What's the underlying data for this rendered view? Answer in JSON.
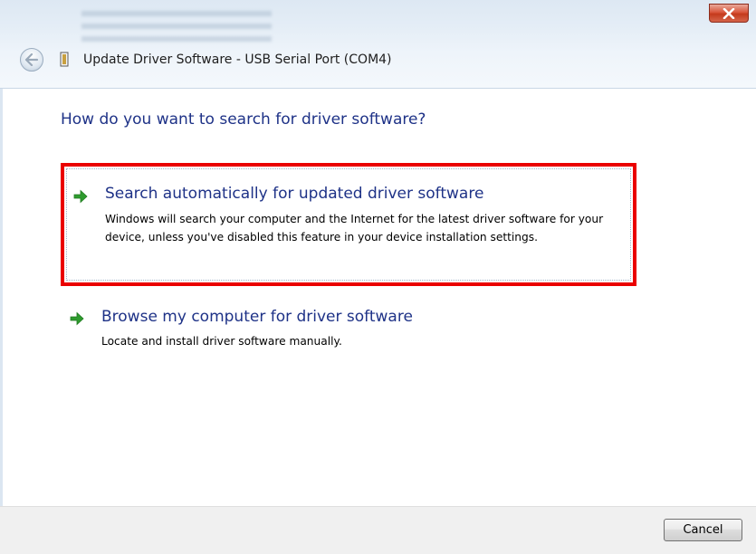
{
  "window": {
    "title": "Update Driver Software -  USB Serial Port (COM4)",
    "close_icon": "close-icon",
    "back_icon": "back-arrow-icon",
    "device_icon": "usb-device-icon"
  },
  "main": {
    "heading": "How do you want to search for driver software?",
    "options": [
      {
        "title": "Search automatically for updated driver software",
        "description": "Windows will search your computer and the Internet for the latest driver software for your device, unless you've disabled this feature in your device installation settings.",
        "icon": "green-arrow-icon",
        "highlighted": true,
        "highlight_color": "#ea0000"
      },
      {
        "title": "Browse my computer for driver software",
        "description": "Locate and install driver software manually.",
        "icon": "green-arrow-icon",
        "highlighted": false
      }
    ]
  },
  "footer": {
    "cancel_label": "Cancel"
  },
  "colors": {
    "link_blue": "#1e3287",
    "arrow_green": "#2e9b2e"
  }
}
